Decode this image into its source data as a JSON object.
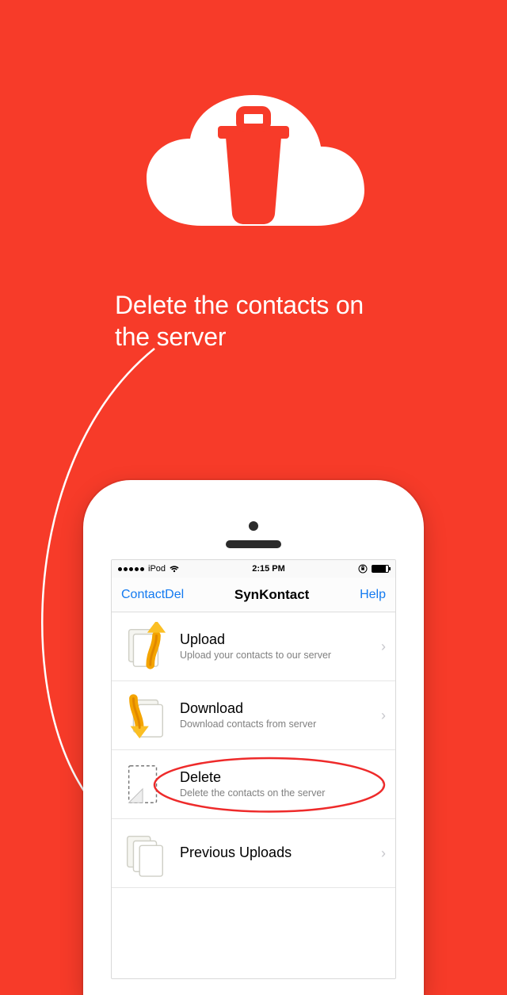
{
  "hero": {
    "caption": "Delete the contacts on the server"
  },
  "device": {
    "carrier": "iPod",
    "time": "2:15 PM"
  },
  "nav": {
    "left": "ContactDel",
    "title": "SynKontact",
    "right": "Help"
  },
  "rows": [
    {
      "icon": "upload-icon",
      "title": "Upload",
      "subtitle": "Upload your contacts to our server"
    },
    {
      "icon": "download-icon",
      "title": "Download",
      "subtitle": "Download contacts from server"
    },
    {
      "icon": "delete-icon",
      "title": "Delete",
      "subtitle": "Delete the contacts on the server",
      "highlighted": true
    },
    {
      "icon": "history-icon",
      "title": "Previous Uploads",
      "subtitle": ""
    }
  ],
  "colors": {
    "background": "#f73b29",
    "iosBlue": "#137af0",
    "highlight": "#ee2a2a"
  }
}
